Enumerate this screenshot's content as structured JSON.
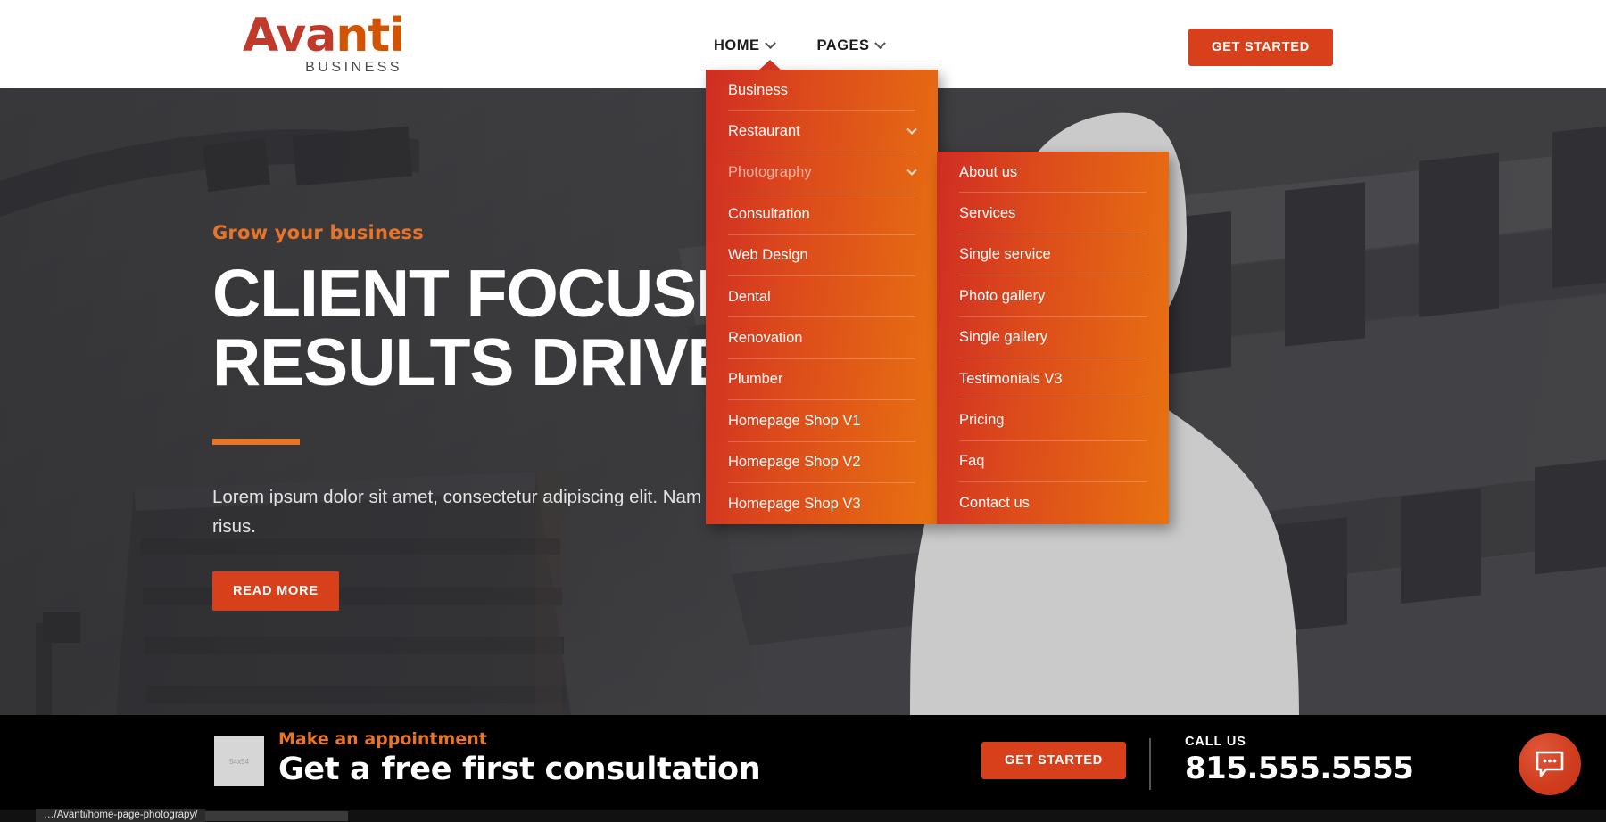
{
  "brand": {
    "name_part1": "Ava",
    "name_part2": "nti",
    "tagline": "BUSINESS",
    "accent_red": "#c0392b",
    "accent_orange": "#d35400",
    "button_color": "#d8401c"
  },
  "header": {
    "nav": [
      {
        "label": "HOME",
        "has_chevron": true,
        "active": true
      },
      {
        "label": "PAGES",
        "has_chevron": true,
        "active": false
      }
    ],
    "cta_label": "GET STARTED"
  },
  "dropdown_main": {
    "items": [
      {
        "label": "Business",
        "has_submenu": false,
        "dimmed": false
      },
      {
        "label": "Restaurant",
        "has_submenu": true,
        "dimmed": false
      },
      {
        "label": "Photography",
        "has_submenu": true,
        "dimmed": true
      },
      {
        "label": "Consultation",
        "has_submenu": false,
        "dimmed": false
      },
      {
        "label": "Web Design",
        "has_submenu": false,
        "dimmed": false
      },
      {
        "label": "Dental",
        "has_submenu": false,
        "dimmed": false
      },
      {
        "label": "Renovation",
        "has_submenu": false,
        "dimmed": false
      },
      {
        "label": "Plumber",
        "has_submenu": false,
        "dimmed": false
      },
      {
        "label": "Homepage Shop V1",
        "has_submenu": false,
        "dimmed": false
      },
      {
        "label": "Homepage Shop V2",
        "has_submenu": false,
        "dimmed": false
      },
      {
        "label": "Homepage Shop V3",
        "has_submenu": false,
        "dimmed": false
      }
    ]
  },
  "dropdown_sub": {
    "items": [
      {
        "label": "About us"
      },
      {
        "label": "Services"
      },
      {
        "label": "Single service"
      },
      {
        "label": "Photo gallery"
      },
      {
        "label": "Single gallery"
      },
      {
        "label": "Testimonials V3"
      },
      {
        "label": "Pricing"
      },
      {
        "label": "Faq"
      },
      {
        "label": "Contact us"
      }
    ]
  },
  "hero": {
    "eyebrow": "Grow your business",
    "title_line1": "CLIENT FOCUSED",
    "title_line2": "RESULTS DRIVEN",
    "paragraph": "Lorem ipsum dolor sit amet, consectetur adipiscing elit. Nam imperdiet risus.",
    "cta_label": "READ MORE"
  },
  "cta_bar": {
    "thumb_placeholder": "54x54",
    "kicker": "Make an appointment",
    "headline": "Get a free first consultation",
    "button_label": "GET STARTED",
    "call_label": "CALL US",
    "phone": "815.555.5555"
  },
  "chat": {
    "icon": "chat-bubble-icon"
  },
  "statusbar": {
    "url": "…/Avanti/home-page-photograpy/"
  }
}
